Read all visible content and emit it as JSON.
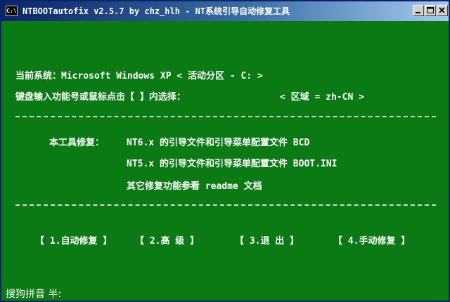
{
  "window": {
    "title": "NTBOOTautofix v2.5.7 by chz_hlh - NT系统引导自动修复工具",
    "icon_text": "C:\\"
  },
  "console": {
    "current_system": "当前系统：Microsoft Windows XP  < 活动分区 - C: >",
    "prompt": "键盘输入功能号或鼠标点击【 】内选择：",
    "region": "< 区域 = zh-CN >",
    "repair_heading": "本工具修复：",
    "repair_nt6": "NT6.x 的引导文件和引导菜单配置文件 BCD",
    "repair_nt5": "NT5.x 的引导文件和引导菜单配置文件 BOOT.INI",
    "repair_other": "其它修复功能参看 readme 文档",
    "buttons": {
      "auto": "【 1.自动修复 】",
      "advanced": "【  2.高  级  】",
      "exit": "【  3.退  出  】",
      "manual": "【 4.手动修复 】"
    }
  },
  "ime_status": "搜狗拼音 半:",
  "colors": {
    "console_bg": "#0b7a14",
    "text": "#ffffff",
    "title_bar": "#0a246a"
  }
}
